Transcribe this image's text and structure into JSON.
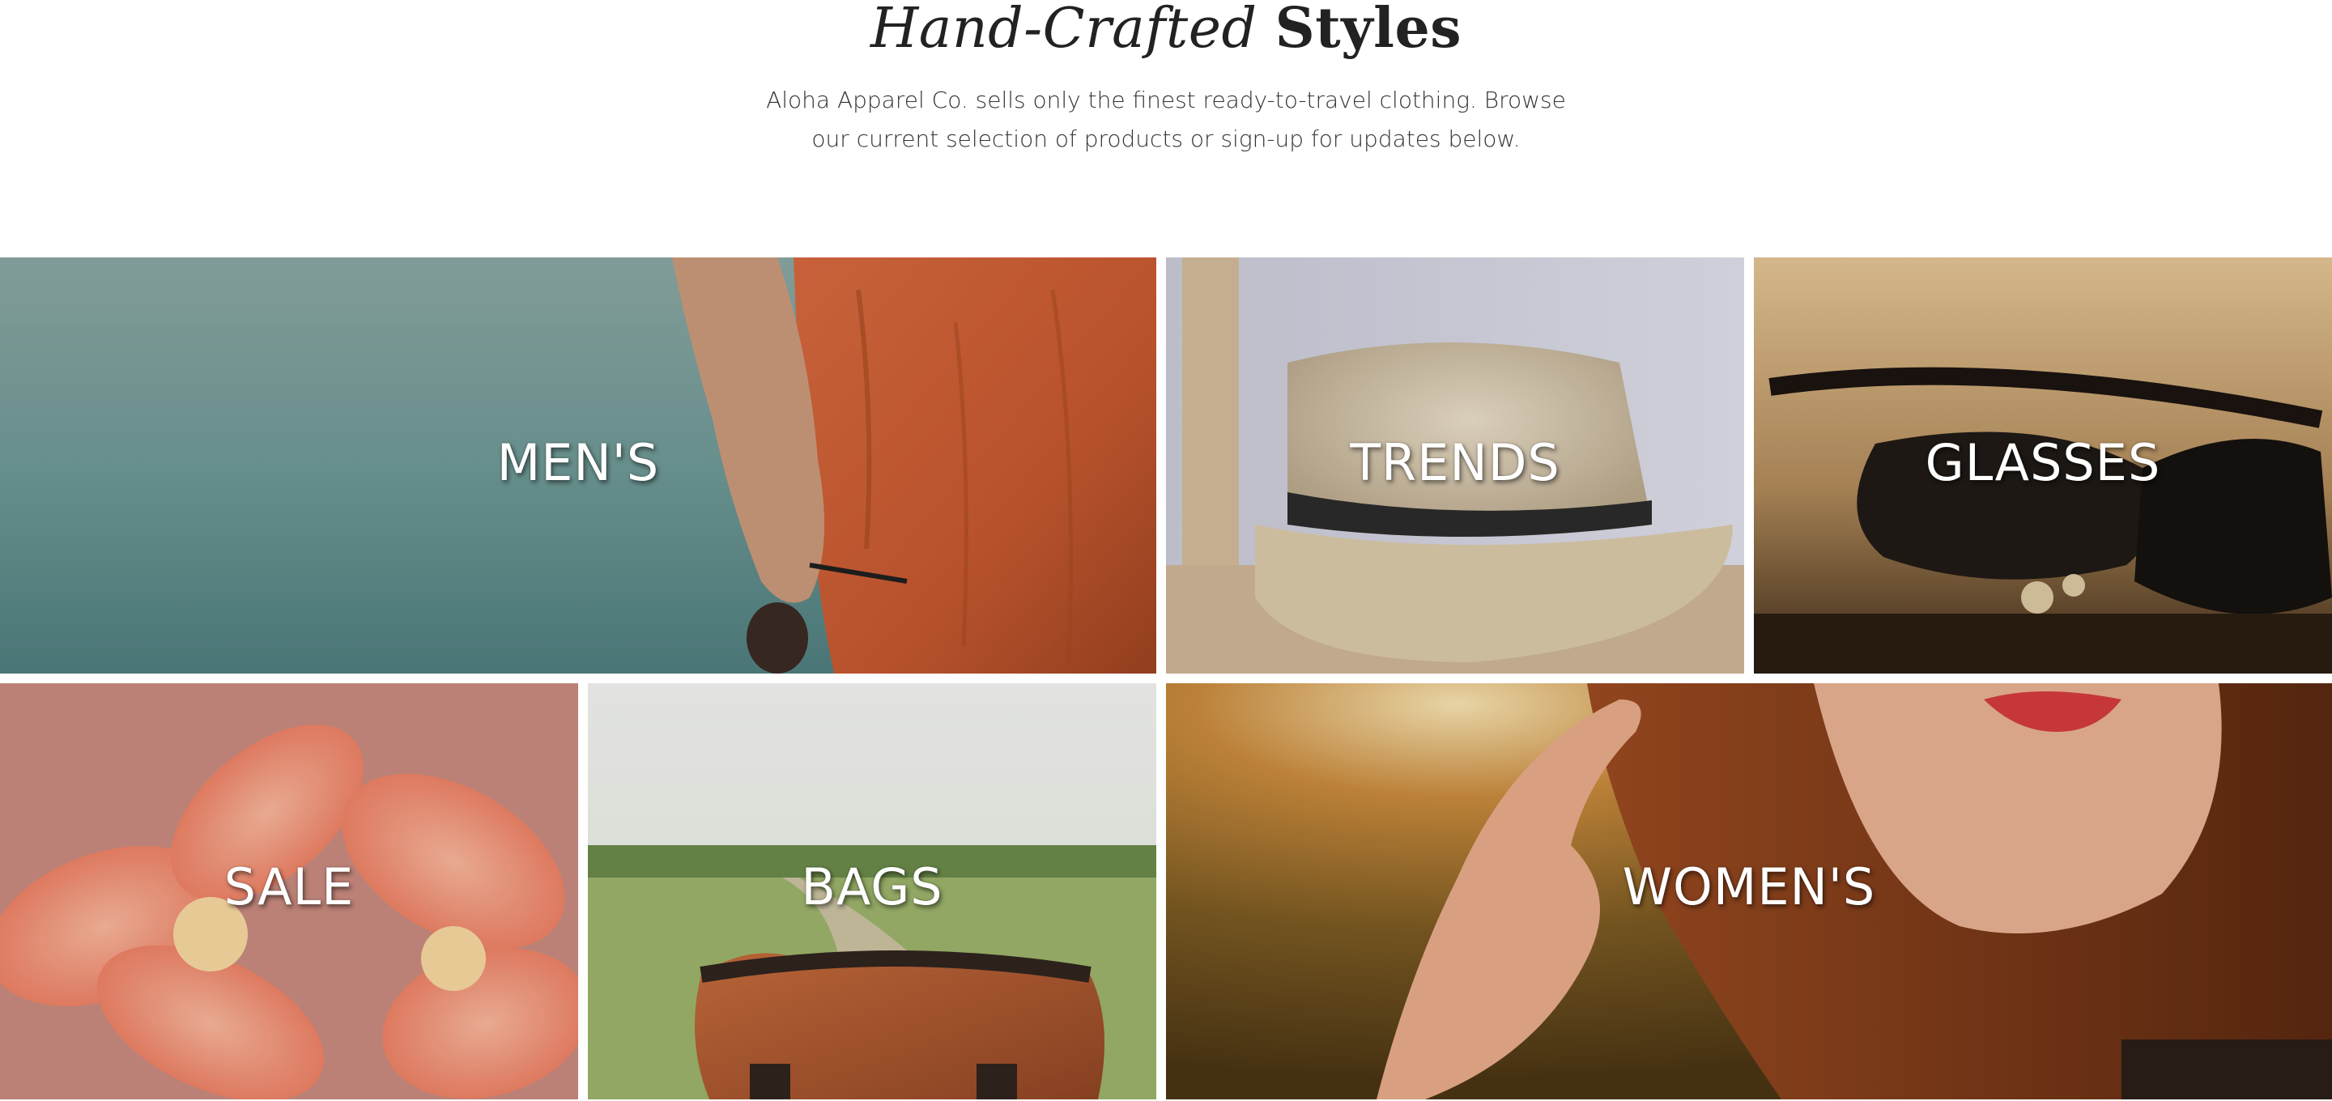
{
  "intro": {
    "title_script": "Hand-Crafted",
    "title_bold": "Styles",
    "description": "Aloha Apparel Co. sells only the finest ready-to-travel clothing. Browse our current selection of products or sign-up for updates below."
  },
  "categories": [
    {
      "label": "MEN'S"
    },
    {
      "label": "TRENDS"
    },
    {
      "label": "GLASSES"
    },
    {
      "label": "SALE"
    },
    {
      "label": "BAGS"
    },
    {
      "label": "WOMEN'S"
    }
  ],
  "colors": {
    "heading": "#222222",
    "body_text": "#333333",
    "tile_label": "#ffffff"
  }
}
